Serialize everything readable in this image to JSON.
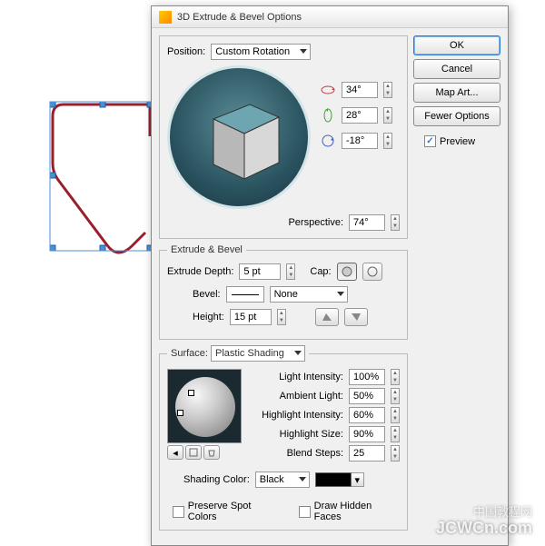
{
  "dialog": {
    "title": "3D Extrude & Bevel Options",
    "position": {
      "label": "Position:",
      "value": "Custom Rotation"
    },
    "rotation": {
      "x": "34°",
      "y": "28°",
      "z": "-18°"
    },
    "perspective": {
      "label": "Perspective:",
      "value": "74°"
    },
    "extrude": {
      "legend": "Extrude & Bevel",
      "depth_label": "Extrude Depth:",
      "depth_value": "5 pt",
      "cap_label": "Cap:",
      "bevel_label": "Bevel:",
      "bevel_value": "None",
      "height_label": "Height:",
      "height_value": "15 pt"
    },
    "surface": {
      "legend": "Surface:",
      "type": "Plastic Shading",
      "light_intensity": {
        "label": "Light Intensity:",
        "value": "100%"
      },
      "ambient_light": {
        "label": "Ambient Light:",
        "value": "50%"
      },
      "highlight_intensity": {
        "label": "Highlight Intensity:",
        "value": "60%"
      },
      "highlight_size": {
        "label": "Highlight Size:",
        "value": "90%"
      },
      "blend_steps": {
        "label": "Blend Steps:",
        "value": "25"
      },
      "shading_color_label": "Shading Color:",
      "shading_color_value": "Black"
    },
    "checks": {
      "preserve_spot": "Preserve Spot Colors",
      "draw_hidden": "Draw Hidden Faces"
    },
    "buttons": {
      "ok": "OK",
      "cancel": "Cancel",
      "map_art": "Map Art...",
      "fewer_options": "Fewer Options"
    },
    "preview_label": "Preview"
  },
  "watermark": {
    "top": "中国教程网",
    "bottom": "JCWCn.com"
  }
}
